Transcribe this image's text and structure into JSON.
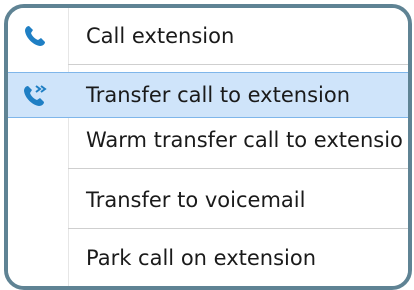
{
  "menu": {
    "items": [
      {
        "label": "Call extension",
        "icon": "phone-icon"
      },
      {
        "label": "Transfer call to extension",
        "icon": "phone-transfer-icon",
        "highlighted": true
      },
      {
        "label": "Warm transfer call to extensio",
        "icon": null
      },
      {
        "label": "Transfer to voicemail",
        "icon": null
      },
      {
        "label": "Park call on extension",
        "icon": null
      }
    ]
  },
  "colors": {
    "frame_border": "#5f8394",
    "highlight_bg": "#cfe4fa",
    "highlight_border": "#7fb6ea",
    "icon_blue": "#1f7fc4"
  }
}
